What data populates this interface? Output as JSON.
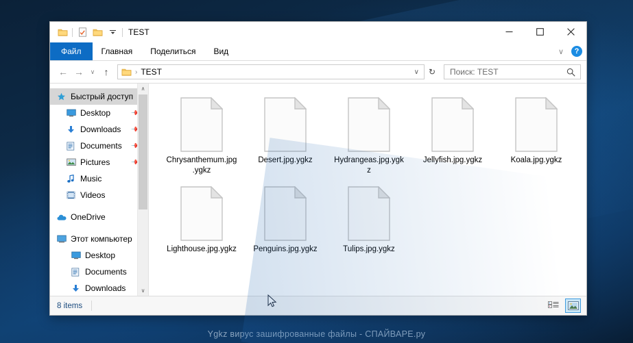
{
  "window": {
    "title": "TEST",
    "quick_access": [
      {
        "name": "folder-icon",
        "label": "Folder"
      },
      {
        "name": "properties-icon",
        "label": "Properties"
      },
      {
        "name": "new-folder-icon",
        "label": "New folder"
      },
      {
        "name": "customize-dropdown-icon",
        "label": "Customize Quick Access Toolbar"
      }
    ],
    "controls": {
      "minimize": "—",
      "maximize": "☐",
      "close": "✕"
    }
  },
  "ribbon": {
    "tabs": [
      {
        "label": "Файл",
        "selected": true
      },
      {
        "label": "Главная",
        "selected": false
      },
      {
        "label": "Поделиться",
        "selected": false
      },
      {
        "label": "Вид",
        "selected": false
      }
    ],
    "expand_label": "∨",
    "help_label": "?"
  },
  "addressbar": {
    "back": "←",
    "forward": "→",
    "recent": "∨",
    "up": "↑",
    "breadcrumb_separator": "›",
    "breadcrumb_text": "TEST",
    "dropdown": "∨",
    "refresh": "↻"
  },
  "search": {
    "placeholder": "Поиск: TEST",
    "icon": "search-icon"
  },
  "sidebar": {
    "items": [
      {
        "label": "Быстрый доступ",
        "icon": "star-icon",
        "selected": true,
        "pinned": false,
        "indent": 0
      },
      {
        "label": "Desktop",
        "icon": "desktop-icon",
        "selected": false,
        "pinned": true,
        "indent": 1
      },
      {
        "label": "Downloads",
        "icon": "download-icon",
        "selected": false,
        "pinned": true,
        "indent": 1
      },
      {
        "label": "Documents",
        "icon": "documents-icon",
        "selected": false,
        "pinned": true,
        "indent": 1
      },
      {
        "label": "Pictures",
        "icon": "pictures-icon",
        "selected": false,
        "pinned": true,
        "indent": 1
      },
      {
        "label": "Music",
        "icon": "music-icon",
        "selected": false,
        "pinned": false,
        "indent": 1
      },
      {
        "label": "Videos",
        "icon": "videos-icon",
        "selected": false,
        "pinned": false,
        "indent": 1
      },
      {
        "label": "OneDrive",
        "icon": "cloud-icon",
        "selected": false,
        "pinned": false,
        "indent": 0
      },
      {
        "label": "Этот компьютер",
        "icon": "computer-icon",
        "selected": false,
        "pinned": false,
        "indent": 0
      },
      {
        "label": "Desktop",
        "icon": "desktop-icon",
        "selected": false,
        "pinned": false,
        "indent": 2
      },
      {
        "label": "Documents",
        "icon": "documents-icon",
        "selected": false,
        "pinned": false,
        "indent": 2
      },
      {
        "label": "Downloads",
        "icon": "download-icon",
        "selected": false,
        "pinned": false,
        "indent": 2
      }
    ],
    "scroll_up": "∧",
    "scroll_down": "∨"
  },
  "files": [
    {
      "name": "Chrysanthemum.jpg.ygkz",
      "icon": "blank-file-icon"
    },
    {
      "name": "Desert.jpg.ygkz",
      "icon": "blank-file-icon"
    },
    {
      "name": "Hydrangeas.jpg.ygkz",
      "icon": "blank-file-icon"
    },
    {
      "name": "Jellyfish.jpg.ygkz",
      "icon": "blank-file-icon"
    },
    {
      "name": "Koala.jpg.ygkz",
      "icon": "blank-file-icon"
    },
    {
      "name": "Lighthouse.jpg.ygkz",
      "icon": "blank-file-icon"
    },
    {
      "name": "Penguins.jpg.ygkz",
      "icon": "blank-file-icon"
    },
    {
      "name": "Tulips.jpg.ygkz",
      "icon": "blank-file-icon"
    }
  ],
  "statusbar": {
    "item_count": "8 items",
    "views": [
      {
        "name": "details-view-button",
        "selected": false
      },
      {
        "name": "large-icons-view-button",
        "selected": true
      }
    ]
  },
  "desktop": {
    "watermark": "Ygkz вирус зашифрованные файлы - СПАЙВАРЕ.ру"
  },
  "colors": {
    "accent_blue": "#0d6cc4",
    "selection_gray": "#d6d6d6",
    "status_text": "#1b4b7e",
    "view_selected_border": "#3d9be0"
  }
}
